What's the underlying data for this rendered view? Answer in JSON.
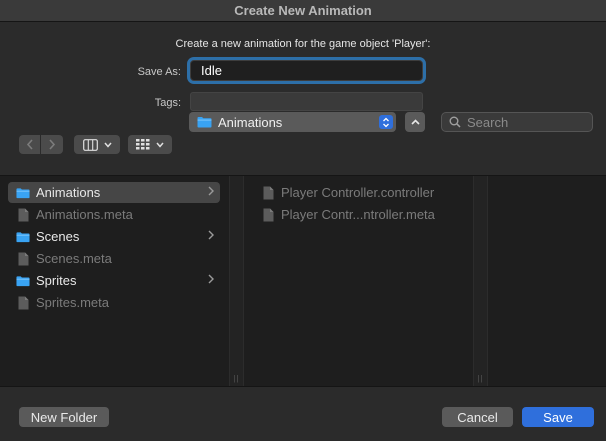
{
  "window": {
    "title": "Create New Animation"
  },
  "dialog": {
    "prompt": "Create a new animation for the game object 'Player':",
    "save_as_label": "Save As:",
    "save_as_value": "Idle",
    "tags_label": "Tags:",
    "tags_value": ""
  },
  "toolbar": {
    "location": "Animations",
    "search_placeholder": "Search"
  },
  "sidebar": {
    "items": [
      {
        "label": "Animations",
        "type": "folder"
      },
      {
        "label": "Animations.meta",
        "type": "file"
      },
      {
        "label": "Scenes",
        "type": "folder"
      },
      {
        "label": "Scenes.meta",
        "type": "file"
      },
      {
        "label": "Sprites",
        "type": "folder"
      },
      {
        "label": "Sprites.meta",
        "type": "file"
      }
    ]
  },
  "content": {
    "items": [
      {
        "label": "Player Controller.controller",
        "type": "file"
      },
      {
        "label": "Player Contr...ntroller.meta",
        "type": "file"
      }
    ]
  },
  "footer": {
    "new_folder": "New Folder",
    "cancel": "Cancel",
    "save": "Save"
  },
  "colors": {
    "accent": "#2f6fdc",
    "focus_ring": "#2d6fa8",
    "folder": "#39a3f3"
  }
}
